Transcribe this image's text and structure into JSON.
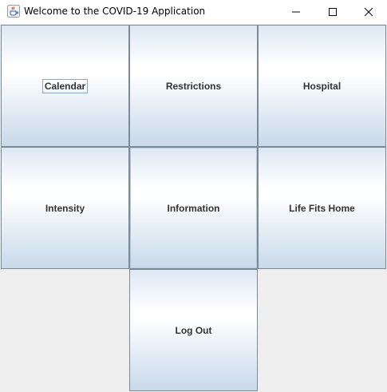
{
  "window": {
    "title": "Welcome to the COVID-19 Application",
    "icon": "java-coffee-cup-icon",
    "controls": {
      "minimize_icon": "minimize-icon",
      "maximize_icon": "maximize-icon",
      "close_icon": "close-icon"
    }
  },
  "grid": {
    "buttons": [
      {
        "label": "Calendar"
      },
      {
        "label": "Restrictions"
      },
      {
        "label": "Hospital"
      },
      {
        "label": "Intensity"
      },
      {
        "label": "Information"
      },
      {
        "label": "Life Fits Home"
      },
      {
        "label": "Log Out"
      }
    ]
  },
  "colors": {
    "panel_background": "#eeeeee",
    "button_border": "#7a8a99",
    "button_gradient_top": "#dde8f3",
    "button_gradient_bottom": "#c8d9ea",
    "label_color": "#333333"
  }
}
